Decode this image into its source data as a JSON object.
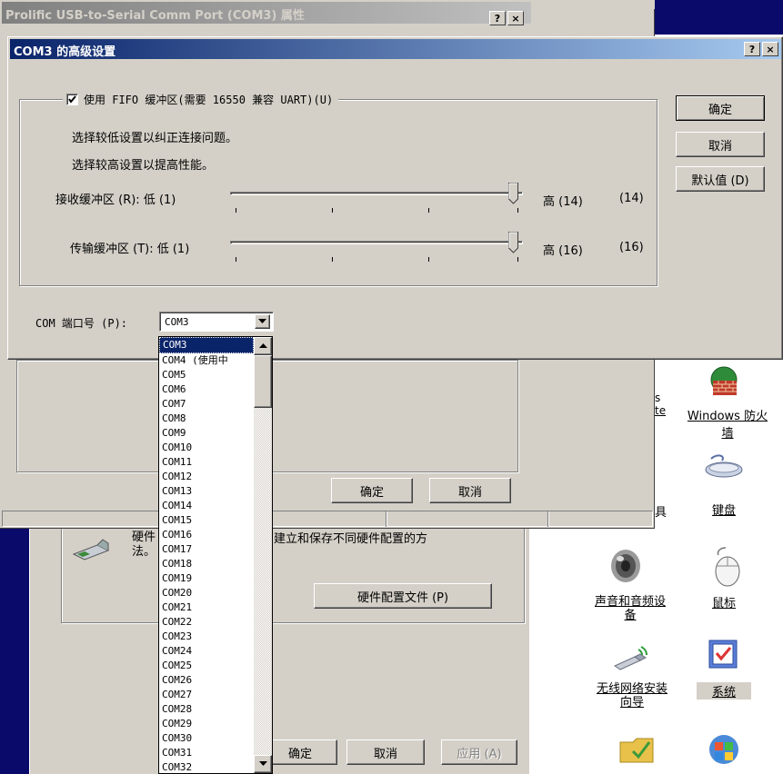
{
  "back_window": {
    "title": "Prolific USB-to-Serial Comm Port (COM3) 属性",
    "help_btn": "?",
    "close_btn": "×",
    "ok_label": "确定",
    "cancel_label": "取消"
  },
  "system_props": {
    "hw_profile_text_1": "硬件",
    "hw_profile_text_2": "法。",
    "hw_profile_text_3": "建立和保存不同硬件配置的方",
    "hw_profile_button": "硬件配置文件 (P)",
    "ok_label": "确定",
    "cancel_label": "取消",
    "apply_label": "应用 (A)"
  },
  "control_panel": {
    "items": [
      {
        "label": "Windows 防火墙",
        "icon": "firewall-icon"
      },
      {
        "label": "键盘",
        "icon": "keyboard-icon"
      },
      {
        "label": "声音和音频设备",
        "icon": "speaker-icon"
      },
      {
        "label": "鼠标",
        "icon": "mouse-icon"
      },
      {
        "label": "无线网络安装向导",
        "icon": "wireless-usb-icon"
      },
      {
        "label": "系统",
        "icon": "system-icon"
      }
    ],
    "partial_1": "s",
    "partial_2": "te",
    "partial_3": "具"
  },
  "dialog": {
    "title": "COM3 的高级设置",
    "help_btn": "?",
    "close_btn": "×",
    "fifo_checkbox": "使用 FIFO 缓冲区(需要 16550 兼容 UART)(U)",
    "fifo_checked": true,
    "hint_low": "选择较低设置以纠正连接问题。",
    "hint_high": "选择较高设置以提高性能。",
    "receive_label": "接收缓冲区 (R): 低 (1)",
    "receive_high": "高 (14)",
    "receive_value": "(14)",
    "receive_level": 1.0,
    "transmit_label": "传输缓冲区 (T): 低 (1)",
    "transmit_high": "高 (16)",
    "transmit_value": "(16)",
    "transmit_level": 1.0,
    "ok_label": "确定",
    "cancel_label": "取消",
    "defaults_label": "默认值 (D)",
    "port_label": "COM 端口号 (P):",
    "port_value": "COM3",
    "port_options": [
      "COM3",
      "COM4 (使用中",
      "COM5",
      "COM6",
      "COM7",
      "COM8",
      "COM9",
      "COM10",
      "COM11",
      "COM12",
      "COM13",
      "COM14",
      "COM15",
      "COM16",
      "COM17",
      "COM18",
      "COM19",
      "COM20",
      "COM21",
      "COM22",
      "COM23",
      "COM24",
      "COM25",
      "COM26",
      "COM27",
      "COM28",
      "COM29",
      "COM30",
      "COM31",
      "COM32"
    ]
  },
  "colors": {
    "active_title": "#0a246a",
    "face": "#d4d0c8",
    "selection": "#0a246a"
  }
}
